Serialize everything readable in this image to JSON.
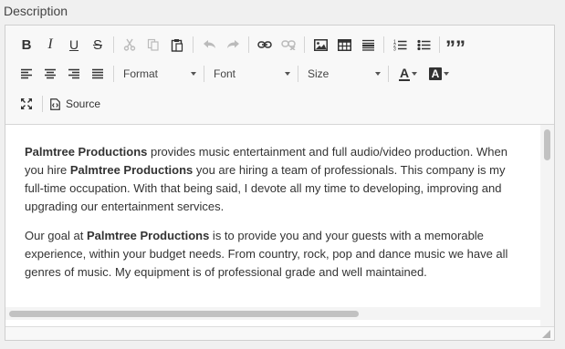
{
  "field": {
    "label": "Description"
  },
  "toolbar": {
    "bold": "B",
    "italic": "I",
    "underline": "U",
    "strike": "S",
    "blockquote": "””",
    "format_label": "Format",
    "font_label": "Font",
    "size_label": "Size",
    "text_color_glyph": "A",
    "bg_color_glyph": "A",
    "source_label": "Source"
  },
  "content": {
    "p1": {
      "bold1": "Palmtree Productions",
      "text1": " provides music entertainment and full audio/video production. When you hire ",
      "bold2": "Palmtree Productions",
      "text2": " you are hiring a team of professionals. This company is my full-time occupation. With that being said, I devote all my time to developing, improving and upgrading our entertainment services."
    },
    "p2": {
      "text1": "Our goal at ",
      "bold1": "Palmtree Productions",
      "text2": " is to provide you and your guests with a memorable experience, within your budget needs. From country, rock, pop and dance music we have all genres of music. My equipment is of professional grade and well maintained."
    }
  }
}
